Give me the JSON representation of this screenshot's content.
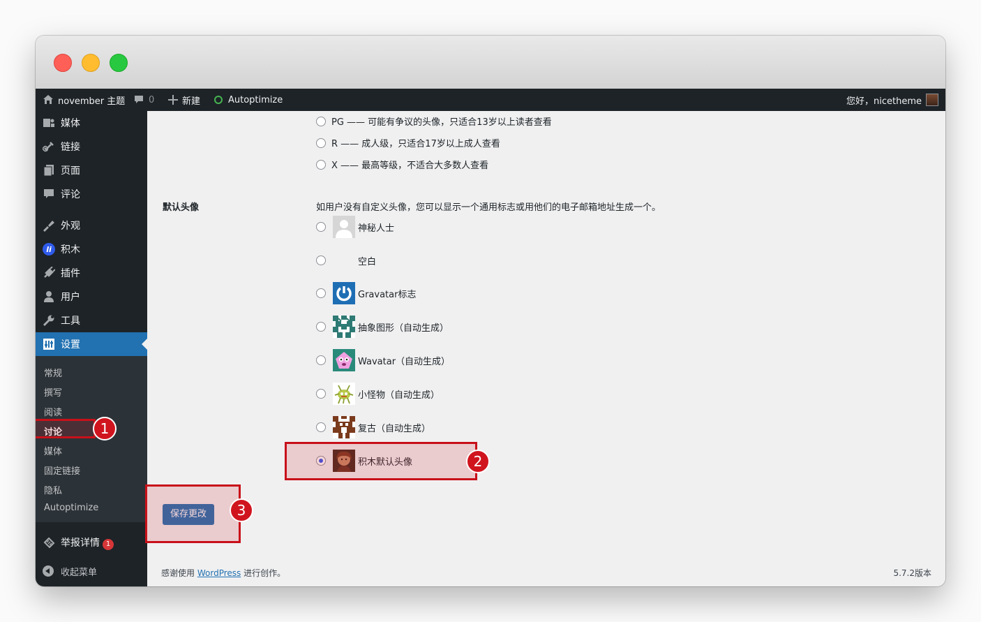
{
  "admin_bar": {
    "site_name": "november 主题",
    "comment_count": "0",
    "new_label": "新建",
    "autoptimize_label": "Autoptimize",
    "greeting": "您好，nicetheme"
  },
  "sidebar": {
    "items": [
      {
        "label": "媒体",
        "icon": "media-icon"
      },
      {
        "label": "链接",
        "icon": "link-icon"
      },
      {
        "label": "页面",
        "icon": "page-icon"
      },
      {
        "label": "评论",
        "icon": "comment-icon"
      },
      {
        "label": "外观",
        "icon": "appearance-icon"
      },
      {
        "label": "积木",
        "icon": "jimu-icon"
      },
      {
        "label": "插件",
        "icon": "plugin-icon"
      },
      {
        "label": "用户",
        "icon": "user-icon"
      },
      {
        "label": "工具",
        "icon": "wrench-icon"
      },
      {
        "label": "设置",
        "icon": "settings-icon"
      }
    ],
    "submenu": [
      "常规",
      "撰写",
      "阅读",
      "讨论",
      "媒体",
      "固定链接",
      "隐私",
      "Autoptimize"
    ],
    "report": {
      "label": "举报详情",
      "badge": "1"
    },
    "collapse_label": "收起菜单"
  },
  "ratings": [
    "PG —— 可能有争议的头像，只适合13岁以上读者查看",
    "R —— 成人级，只适合17岁以上成人查看",
    "X —— 最高等级，不适合大多数人查看"
  ],
  "default_avatar": {
    "label": "默认头像",
    "description": "如用户没有自定义头像，您可以显示一个通用标志或用他们的电子邮箱地址生成一个。",
    "options": [
      {
        "label": "神秘人士",
        "icon": "mystery-person-avatar"
      },
      {
        "label": "空白",
        "icon": "blank-avatar"
      },
      {
        "label": "Gravatar标志",
        "icon": "gravatar-logo-avatar"
      },
      {
        "label": "抽象图形（自动生成）",
        "icon": "identicon-avatar"
      },
      {
        "label": "Wavatar（自动生成）",
        "icon": "wavatar-avatar"
      },
      {
        "label": "小怪物（自动生成）",
        "icon": "monsterid-avatar"
      },
      {
        "label": "复古（自动生成）",
        "icon": "retro-avatar"
      },
      {
        "label": "积木默认头像",
        "icon": "jimu-default-avatar"
      }
    ],
    "selected": "积木默认头像"
  },
  "save_button": "保存更改",
  "footer": {
    "thanks_prefix": "感谢使用",
    "wordpress_link": "WordPress",
    "thanks_suffix": "进行创作。",
    "version": "5.7.2版本"
  },
  "annotations": [
    "1",
    "2",
    "3"
  ],
  "colors": {
    "admin_dark": "#1d2327",
    "accent": "#2271b1",
    "highlight": "#c8101a"
  }
}
